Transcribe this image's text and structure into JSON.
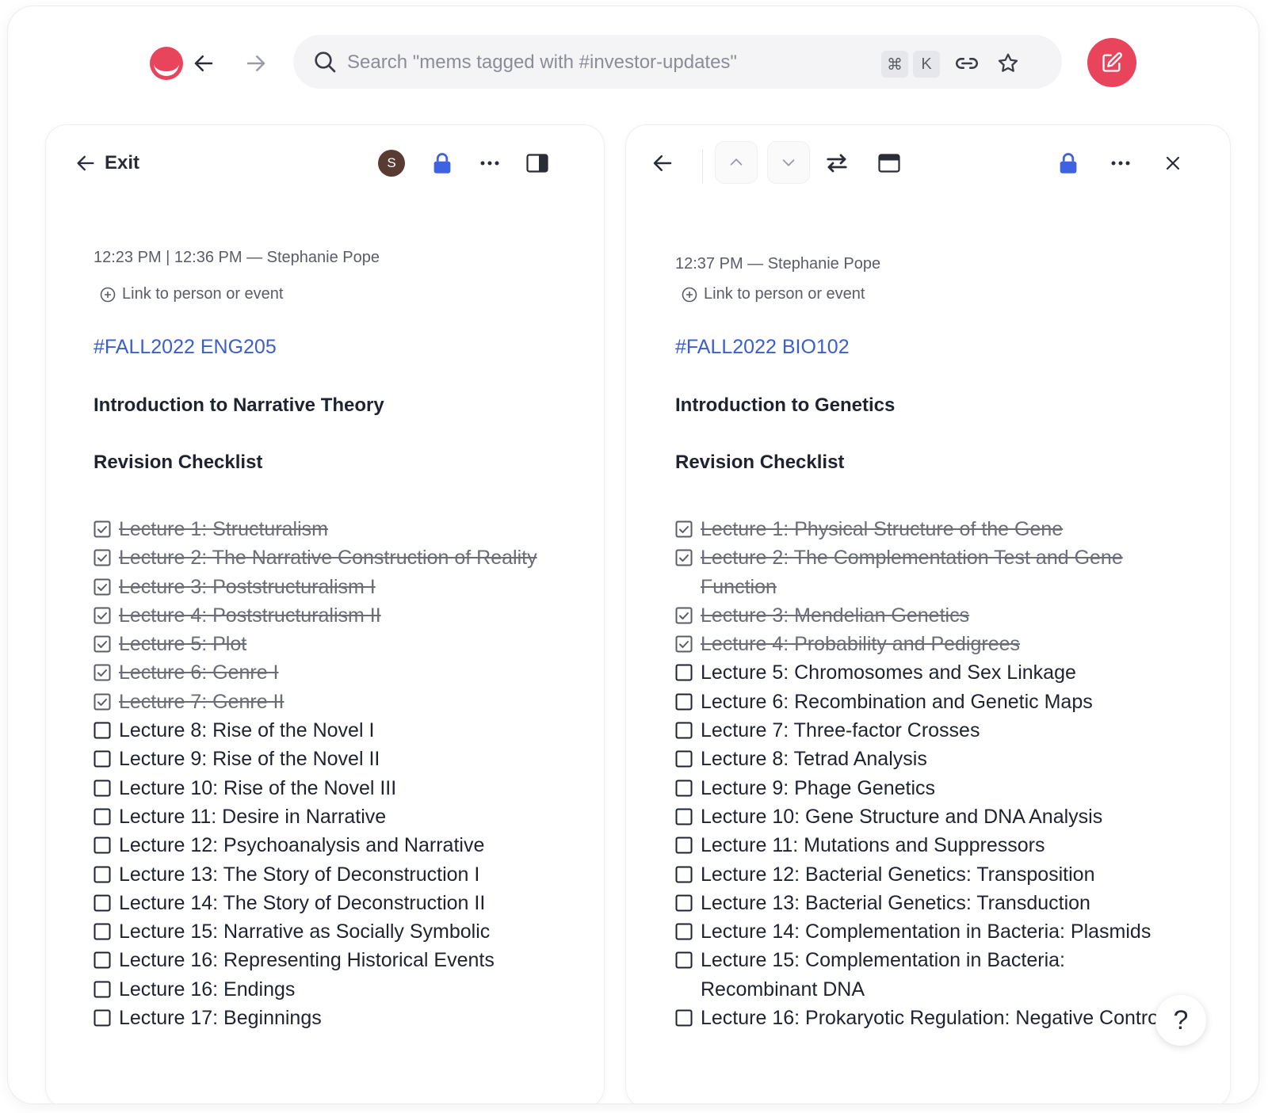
{
  "app": {
    "accent": "#e8445c",
    "link_color": "#3a5fc8",
    "lock_color": "#3f62e0"
  },
  "topbar": {
    "search_placeholder": "Search \"mems tagged with #investor-updates\"",
    "shortcut_keys": [
      "⌘",
      "K"
    ]
  },
  "left_panel": {
    "exit_label": "Exit",
    "avatar_initial": "S",
    "meta": "12:23 PM | 12:36 PM — Stephanie Pope",
    "link_label": "Link to person or event",
    "tag": "#FALL2022 ENG205",
    "title": "Introduction to Narrative Theory",
    "section": "Revision Checklist",
    "items": [
      {
        "text": "Lecture 1: Structuralism",
        "done": true
      },
      {
        "text": "Lecture 2: The Narrative Construction of Reality",
        "done": true
      },
      {
        "text": "Lecture 3: Poststructuralism I",
        "done": true
      },
      {
        "text": "Lecture 4: Poststructuralism II",
        "done": true
      },
      {
        "text": "Lecture 5: Plot",
        "done": true
      },
      {
        "text": "Lecture 6: Genre I",
        "done": true
      },
      {
        "text": "Lecture 7: Genre II",
        "done": true
      },
      {
        "text": "Lecture 8: Rise of the Novel I",
        "done": false
      },
      {
        "text": "Lecture 9: Rise of the Novel II",
        "done": false
      },
      {
        "text": "Lecture 10: Rise of the Novel III",
        "done": false
      },
      {
        "text": "Lecture 11: Desire in Narrative",
        "done": false
      },
      {
        "text": "Lecture 12: Psychoanalysis and Narrative",
        "done": false
      },
      {
        "text": "Lecture 13: The Story of Deconstruction I",
        "done": false
      },
      {
        "text": "Lecture 14: The Story of Deconstruction II",
        "done": false
      },
      {
        "text": "Lecture 15: Narrative as Socially Symbolic",
        "done": false
      },
      {
        "text": "Lecture 16: Representing Historical Events",
        "done": false
      },
      {
        "text": "Lecture 16: Endings",
        "done": false
      },
      {
        "text": "Lecture 17: Beginnings",
        "done": false
      }
    ]
  },
  "right_panel": {
    "meta": "12:37 PM — Stephanie Pope",
    "link_label": "Link to person or event",
    "tag": "#FALL2022 BIO102",
    "title": "Introduction to Genetics",
    "section": "Revision Checklist",
    "items": [
      {
        "text": "Lecture 1: Physical Structure of the Gene",
        "done": true
      },
      {
        "text": "Lecture 2: The Complementation Test and Gene Function",
        "done": true
      },
      {
        "text": "Lecture 3: Mendelian Genetics",
        "done": true
      },
      {
        "text": "Lecture 4: Probability and Pedigrees",
        "done": true
      },
      {
        "text": "Lecture 5: Chromosomes and Sex Linkage",
        "done": false
      },
      {
        "text": "Lecture 6: Recombination and Genetic Maps",
        "done": false
      },
      {
        "text": "Lecture 7: Three-factor Crosses",
        "done": false
      },
      {
        "text": "Lecture 8: Tetrad Analysis",
        "done": false
      },
      {
        "text": "Lecture 9: Phage Genetics",
        "done": false
      },
      {
        "text": "Lecture 10: Gene Structure and DNA Analysis",
        "done": false
      },
      {
        "text": "Lecture 11: Mutations and Suppressors",
        "done": false
      },
      {
        "text": "Lecture 12: Bacterial Genetics: Transposition",
        "done": false
      },
      {
        "text": "Lecture 13: Bacterial Genetics: Transduction",
        "done": false
      },
      {
        "text": "Lecture 14: Complementation in Bacteria: Plasmids",
        "done": false
      },
      {
        "text": "Lecture 15: Complementation in Bacteria: Recombinant DNA",
        "done": false
      },
      {
        "text": "Lecture 16: Prokaryotic Regulation: Negative Control",
        "done": false
      }
    ]
  },
  "help_label": "?"
}
